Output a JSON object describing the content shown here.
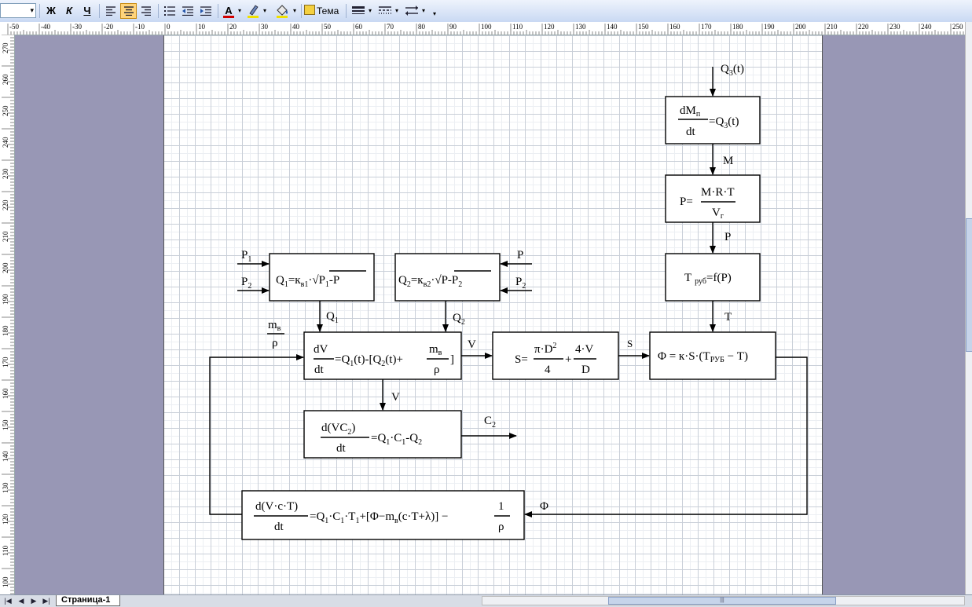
{
  "toolbar": {
    "bold": "Ж",
    "italic": "К",
    "underline": "Ч",
    "theme_label": "Тема",
    "font_color": "#d00000",
    "highlight_color": "#f0e000"
  },
  "tabs": {
    "page1": "Страница-1"
  },
  "ruler": {
    "h_labels": [
      "-50",
      "-40",
      "-30",
      "-20",
      "-10",
      "0",
      "10",
      "20",
      "30",
      "40",
      "50",
      "60",
      "70",
      "80",
      "90",
      "100",
      "110",
      "120",
      "130",
      "140",
      "150",
      "160",
      "170",
      "180",
      "190",
      "200",
      "210",
      "220",
      "230",
      "240",
      "250"
    ],
    "v_labels": [
      "270",
      "260",
      "250",
      "240",
      "230",
      "220",
      "210",
      "200",
      "190",
      "180",
      "170",
      "160",
      "150",
      "140",
      "130",
      "120",
      "110",
      "100"
    ]
  },
  "diagram": {
    "blocks": {
      "mass": {
        "num": "dM",
        "num_sub": "п",
        "den": "dt",
        "rhs": "=Q",
        "rhs_sub": "3",
        "rhs_tail": "(t)"
      },
      "pressure": {
        "lhs": "P=",
        "num": "M·R·T",
        "den": "V",
        "den_sub": "г"
      },
      "temp": {
        "text": "T",
        "sub": "руб",
        "tail": "=f(P)"
      },
      "q1": {
        "t1": "Q",
        "s1": "1",
        "t2": "=к",
        "s2": "в1",
        "t3": "·√",
        "t4": "P",
        "s4": "1",
        "t5": "-P"
      },
      "q2": {
        "t1": "Q",
        "s1": "2",
        "t2": "=к",
        "s2": "в2",
        "t3": "·√",
        "t4": "P-P",
        "s4": "2"
      },
      "volume": {
        "num": "dV",
        "den": "dt",
        "rhs": "=Q",
        "s1": "1",
        "rhs2": "(t)-[Q",
        "s2": "2",
        "rhs3": "(t)+",
        "fnum": "m",
        "fnum_sub": "в",
        "fden": "ρ",
        "close": "]"
      },
      "area": {
        "lhs": "S=",
        "f1num": "π·D",
        "f1sup": "2",
        "f1den": "4",
        "plus": "+",
        "f2num": "4·V",
        "f2den": "D"
      },
      "flux": {
        "t1": "Φ = к·S·(T",
        "sub": "РУБ",
        "t2": " − T)"
      },
      "conc": {
        "num": "d(VC",
        "num_sub": "2",
        "num_close": ")",
        "den": "dt",
        "rhs": "=Q",
        "s1": "1",
        "r2": "·C",
        "s2": "1",
        "r3": "-Q",
        "s3": "2"
      },
      "energy": {
        "num": "d(V·c·T)",
        "den": "dt",
        "rhs": "=Q",
        "s1": "1",
        "r2": "·C",
        "s2": "1",
        "r3": "·T",
        "s3": "1",
        "r4": "+[Φ−m",
        "s4": "в",
        "r5": "(c·T+λ)] − ",
        "fnum": "1",
        "fden": "ρ"
      }
    },
    "labels": {
      "q3_in": "Q",
      "q3_in_sub": "3",
      "q3_in_tail": "(t)",
      "m_out": "M",
      "p_out": "P",
      "t_out": "T",
      "p1_in": "P",
      "p1_in_sub": "1",
      "p2_in": "P",
      "p2_in_sub": "2",
      "p_in": "P",
      "p2b_in": "P",
      "p2b_in_sub": "2",
      "q1_out": "Q",
      "q1_out_sub": "1",
      "q2_out": "Q",
      "q2_out_sub": "2",
      "mv_num": "m",
      "mv_num_sub": "в",
      "mv_den": "ρ",
      "v_right": "V",
      "v_down": "V",
      "s_out": "S",
      "c2_out": "C",
      "c2_out_sub": "2",
      "phi_in": "Φ"
    }
  }
}
